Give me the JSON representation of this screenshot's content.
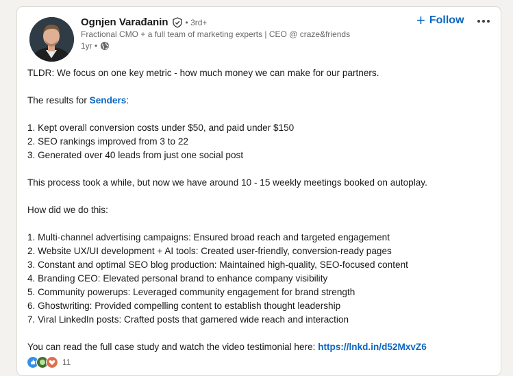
{
  "post": {
    "author": {
      "name": "Ognjen Varađanin",
      "degree": "• 3rd+",
      "headline": "Fractional CMO + a full team of marketing experts | CEO @ craze&friends",
      "time": "1yr •"
    },
    "follow_label": "Follow",
    "body": {
      "line1": "TLDR: We focus on one key metric - how much money we can make for our partners.",
      "results_prefix": "The results for ",
      "results_link": "Senders",
      "results_suffix": ":",
      "results": [
        "1. Kept overall conversion costs under $50, and paid under $150",
        "2. SEO rankings improved from 3 to 22",
        "3. Generated over 40 leads from just one social post"
      ],
      "process": "This process took a while, but now we have around 10 - 15 weekly meetings booked on autoplay.",
      "how": "How did we do this:",
      "steps": [
        "1. Multi-channel advertising campaigns: Ensured broad reach and targeted engagement",
        "2. Website UX/UI development + AI tools: Created user-friendly, conversion-ready pages",
        "3. Constant and optimal SEO blog production: Maintained high-quality, SEO-focused content",
        "4. Branding CEO: Elevated personal brand to enhance company visibility",
        "5. Community powerups: Leveraged community engagement for brand strength",
        "6. Ghostwriting: Provided compelling content to establish thought leadership",
        "7. Viral LinkedIn posts: Crafted posts that garnered wide reach and interaction"
      ],
      "closing_prefix": "You can read the full case study and watch the video testimonial here: ",
      "closing_link": "https://lnkd.in/d52MxvZ6"
    },
    "reactions": {
      "count": "11"
    }
  },
  "colors": {
    "link": "#0a66c2",
    "text": "#191919",
    "muted": "#666666",
    "background": "#f4f2ee"
  },
  "icons": [
    "verified-shield-icon",
    "globe-icon",
    "plus-icon",
    "more-dots-icon",
    "like-reaction-icon",
    "celebrate-reaction-icon",
    "love-reaction-icon"
  ]
}
